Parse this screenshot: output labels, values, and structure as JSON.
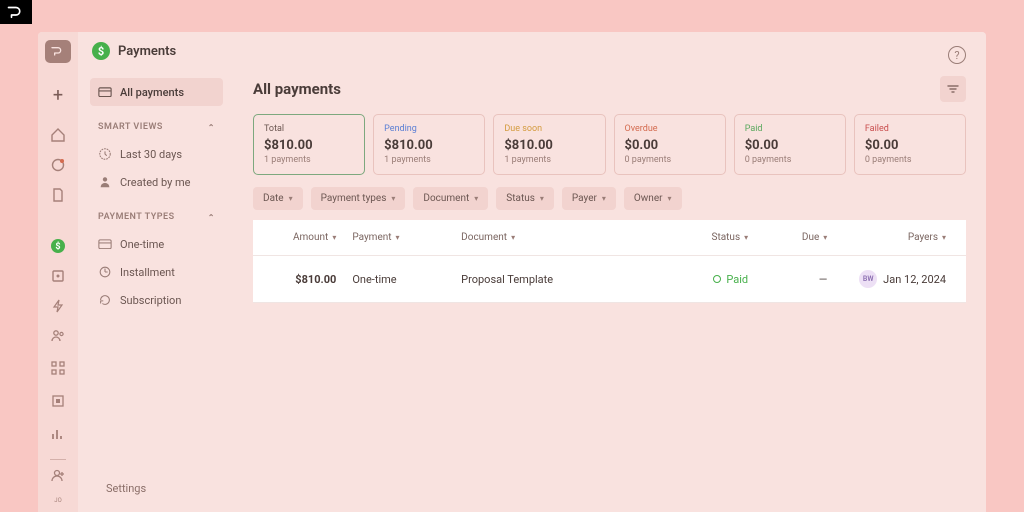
{
  "brand": {
    "initials": "pd"
  },
  "sidebar": {
    "header": "Payments",
    "all_payments": "All payments",
    "sections": {
      "smart_views": "SMART VIEWS",
      "payment_types": "PAYMENT TYPES"
    },
    "smart_views": {
      "last_30": "Last 30 days",
      "created_by_me": "Created by me"
    },
    "payment_types": {
      "one_time": "One-time",
      "installment": "Installment",
      "subscription": "Subscription"
    },
    "settings": "Settings"
  },
  "page": {
    "title": "All payments"
  },
  "summary": {
    "total": {
      "label": "Total",
      "amount": "$810.00",
      "count": "1 payments",
      "color": "#6b5651"
    },
    "pending": {
      "label": "Pending",
      "amount": "$810.00",
      "count": "1 payments",
      "color": "#5b7fd4"
    },
    "due_soon": {
      "label": "Due soon",
      "amount": "$810.00",
      "count": "1 payments",
      "color": "#d49b3f"
    },
    "overdue": {
      "label": "Overdue",
      "amount": "$0.00",
      "count": "0 payments",
      "color": "#d46b4f"
    },
    "paid": {
      "label": "Paid",
      "amount": "$0.00",
      "count": "0 payments",
      "color": "#5aa85e"
    },
    "failed": {
      "label": "Failed",
      "amount": "$0.00",
      "count": "0 payments",
      "color": "#c94e4e"
    }
  },
  "filters": {
    "date": "Date",
    "payment_types": "Payment types",
    "document": "Document",
    "status": "Status",
    "payer": "Payer",
    "owner": "Owner"
  },
  "table": {
    "headers": {
      "amount": "Amount",
      "payment": "Payment",
      "document": "Document",
      "status": "Status",
      "due": "Due",
      "payers": "Payers"
    },
    "rows": [
      {
        "amount": "$810.00",
        "payment": "One-time",
        "document": "Proposal Template",
        "status": "Paid",
        "due": "—",
        "payer_initials": "BW",
        "date": "Jan 12, 2024"
      }
    ]
  }
}
